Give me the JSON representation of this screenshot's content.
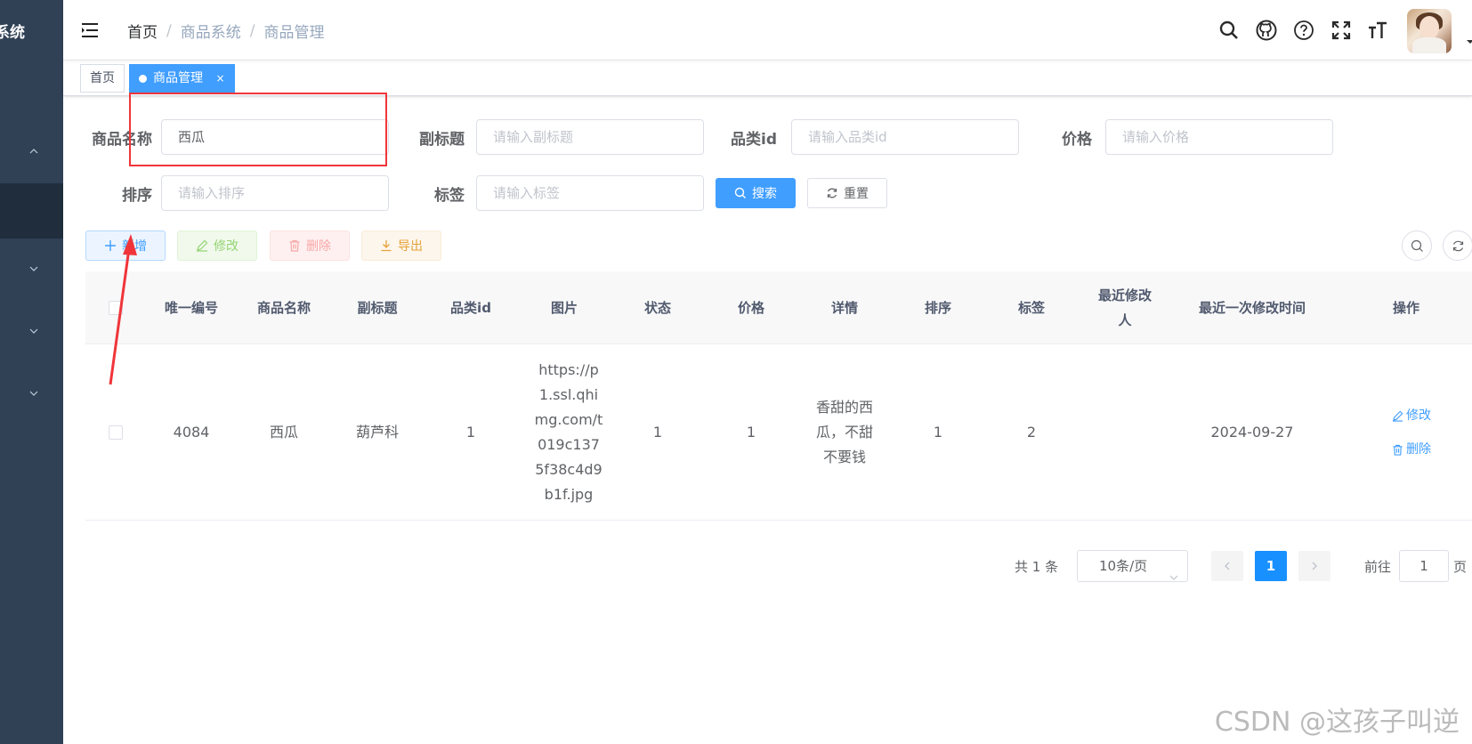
{
  "sidebar": {
    "logo": "系统"
  },
  "navbar": {
    "breadcrumb": [
      "首页",
      "商品系统",
      "商品管理"
    ]
  },
  "tags": [
    {
      "label": "首页"
    },
    {
      "label": "商品管理",
      "close": "×"
    }
  ],
  "search_form": {
    "name": {
      "label": "商品名称",
      "value": "西瓜"
    },
    "subtitle": {
      "label": "副标题",
      "placeholder": "请输入副标题"
    },
    "category": {
      "label": "品类id",
      "placeholder": "请输入品类id"
    },
    "price": {
      "label": "价格",
      "placeholder": "请输入价格"
    },
    "sort": {
      "label": "排序",
      "placeholder": "请输入排序"
    },
    "tags": {
      "label": "标签",
      "placeholder": "请输入标签"
    },
    "search_button": "搜索",
    "reset_button": "重置"
  },
  "toolbar": {
    "add": "新增",
    "edit": "修改",
    "delete": "删除",
    "export": "导出"
  },
  "table": {
    "headers": [
      "唯一编号",
      "商品名称",
      "副标题",
      "品类id",
      "图片",
      "状态",
      "价格",
      "详情",
      "排序",
      "标签",
      "最近修改人",
      "最近一次修改时间",
      "操作"
    ],
    "rows": [
      {
        "id": "4084",
        "name": "西瓜",
        "subtitle": "葫芦科",
        "category": "1",
        "image": "https://p1.ssl.qhimg.com/t019c1375f38c4d9b1f.jpg",
        "status": "1",
        "price": "1",
        "detail": "香甜的西瓜，不甜不要钱",
        "sort": "1",
        "tags": "2",
        "modifier": "",
        "modified_time": "2024-09-27",
        "op_edit": "修改",
        "op_delete": "删除"
      }
    ]
  },
  "pagination": {
    "total": "共 1 条",
    "page_size": "10条/页",
    "current": "1",
    "goto_label": "前往",
    "goto_value": "1",
    "goto_suffix": "页"
  },
  "watermark": "CSDN @这孩子叫逆"
}
